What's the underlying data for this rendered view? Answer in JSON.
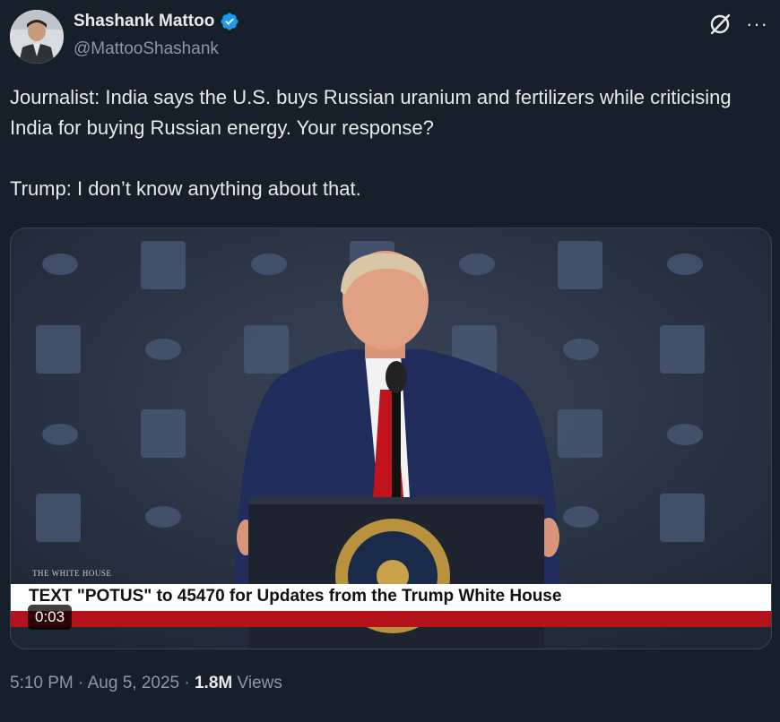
{
  "author": {
    "name": "Shashank Mattoo",
    "handle": "@MattooShashank",
    "verified": true,
    "badge_color": "#1d9bf0"
  },
  "actions": {
    "grok_icon": "grok-icon",
    "more_icon": "more-icon",
    "more_label": "···"
  },
  "tweet": {
    "text": "Journalist: India says the U.S. buys Russian uranium and fertilizers while criticising India for buying Russian energy. Your response?\n\nTrump: I don’t know anything about that."
  },
  "media": {
    "ticker_text": "TEXT \"POTUS\" to 45470 for Updates from the Trump White House",
    "watermark": "THE WHITE HOUSE",
    "duration": "0:03"
  },
  "meta": {
    "time": "5:10 PM",
    "date": "Aug 5, 2025",
    "separator": " · ",
    "views_count": "1.8M",
    "views_label": "Views"
  },
  "colors": {
    "background": "#15202b",
    "text_primary": "#e7e9ea",
    "text_secondary": "#8b98a5",
    "ticker_red": "#b3141c"
  }
}
